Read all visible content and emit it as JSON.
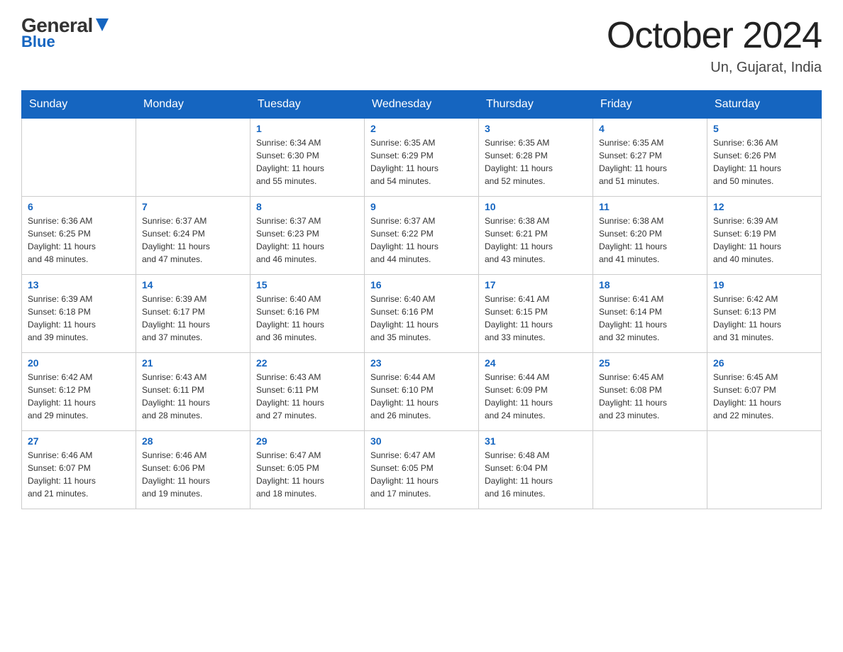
{
  "logo": {
    "general": "General",
    "blue": "Blue"
  },
  "title": "October 2024",
  "location": "Un, Gujarat, India",
  "weekdays": [
    "Sunday",
    "Monday",
    "Tuesday",
    "Wednesday",
    "Thursday",
    "Friday",
    "Saturday"
  ],
  "weeks": [
    [
      {
        "day": "",
        "info": ""
      },
      {
        "day": "",
        "info": ""
      },
      {
        "day": "1",
        "info": "Sunrise: 6:34 AM\nSunset: 6:30 PM\nDaylight: 11 hours\nand 55 minutes."
      },
      {
        "day": "2",
        "info": "Sunrise: 6:35 AM\nSunset: 6:29 PM\nDaylight: 11 hours\nand 54 minutes."
      },
      {
        "day": "3",
        "info": "Sunrise: 6:35 AM\nSunset: 6:28 PM\nDaylight: 11 hours\nand 52 minutes."
      },
      {
        "day": "4",
        "info": "Sunrise: 6:35 AM\nSunset: 6:27 PM\nDaylight: 11 hours\nand 51 minutes."
      },
      {
        "day": "5",
        "info": "Sunrise: 6:36 AM\nSunset: 6:26 PM\nDaylight: 11 hours\nand 50 minutes."
      }
    ],
    [
      {
        "day": "6",
        "info": "Sunrise: 6:36 AM\nSunset: 6:25 PM\nDaylight: 11 hours\nand 48 minutes."
      },
      {
        "day": "7",
        "info": "Sunrise: 6:37 AM\nSunset: 6:24 PM\nDaylight: 11 hours\nand 47 minutes."
      },
      {
        "day": "8",
        "info": "Sunrise: 6:37 AM\nSunset: 6:23 PM\nDaylight: 11 hours\nand 46 minutes."
      },
      {
        "day": "9",
        "info": "Sunrise: 6:37 AM\nSunset: 6:22 PM\nDaylight: 11 hours\nand 44 minutes."
      },
      {
        "day": "10",
        "info": "Sunrise: 6:38 AM\nSunset: 6:21 PM\nDaylight: 11 hours\nand 43 minutes."
      },
      {
        "day": "11",
        "info": "Sunrise: 6:38 AM\nSunset: 6:20 PM\nDaylight: 11 hours\nand 41 minutes."
      },
      {
        "day": "12",
        "info": "Sunrise: 6:39 AM\nSunset: 6:19 PM\nDaylight: 11 hours\nand 40 minutes."
      }
    ],
    [
      {
        "day": "13",
        "info": "Sunrise: 6:39 AM\nSunset: 6:18 PM\nDaylight: 11 hours\nand 39 minutes."
      },
      {
        "day": "14",
        "info": "Sunrise: 6:39 AM\nSunset: 6:17 PM\nDaylight: 11 hours\nand 37 minutes."
      },
      {
        "day": "15",
        "info": "Sunrise: 6:40 AM\nSunset: 6:16 PM\nDaylight: 11 hours\nand 36 minutes."
      },
      {
        "day": "16",
        "info": "Sunrise: 6:40 AM\nSunset: 6:16 PM\nDaylight: 11 hours\nand 35 minutes."
      },
      {
        "day": "17",
        "info": "Sunrise: 6:41 AM\nSunset: 6:15 PM\nDaylight: 11 hours\nand 33 minutes."
      },
      {
        "day": "18",
        "info": "Sunrise: 6:41 AM\nSunset: 6:14 PM\nDaylight: 11 hours\nand 32 minutes."
      },
      {
        "day": "19",
        "info": "Sunrise: 6:42 AM\nSunset: 6:13 PM\nDaylight: 11 hours\nand 31 minutes."
      }
    ],
    [
      {
        "day": "20",
        "info": "Sunrise: 6:42 AM\nSunset: 6:12 PM\nDaylight: 11 hours\nand 29 minutes."
      },
      {
        "day": "21",
        "info": "Sunrise: 6:43 AM\nSunset: 6:11 PM\nDaylight: 11 hours\nand 28 minutes."
      },
      {
        "day": "22",
        "info": "Sunrise: 6:43 AM\nSunset: 6:11 PM\nDaylight: 11 hours\nand 27 minutes."
      },
      {
        "day": "23",
        "info": "Sunrise: 6:44 AM\nSunset: 6:10 PM\nDaylight: 11 hours\nand 26 minutes."
      },
      {
        "day": "24",
        "info": "Sunrise: 6:44 AM\nSunset: 6:09 PM\nDaylight: 11 hours\nand 24 minutes."
      },
      {
        "day": "25",
        "info": "Sunrise: 6:45 AM\nSunset: 6:08 PM\nDaylight: 11 hours\nand 23 minutes."
      },
      {
        "day": "26",
        "info": "Sunrise: 6:45 AM\nSunset: 6:07 PM\nDaylight: 11 hours\nand 22 minutes."
      }
    ],
    [
      {
        "day": "27",
        "info": "Sunrise: 6:46 AM\nSunset: 6:07 PM\nDaylight: 11 hours\nand 21 minutes."
      },
      {
        "day": "28",
        "info": "Sunrise: 6:46 AM\nSunset: 6:06 PM\nDaylight: 11 hours\nand 19 minutes."
      },
      {
        "day": "29",
        "info": "Sunrise: 6:47 AM\nSunset: 6:05 PM\nDaylight: 11 hours\nand 18 minutes."
      },
      {
        "day": "30",
        "info": "Sunrise: 6:47 AM\nSunset: 6:05 PM\nDaylight: 11 hours\nand 17 minutes."
      },
      {
        "day": "31",
        "info": "Sunrise: 6:48 AM\nSunset: 6:04 PM\nDaylight: 11 hours\nand 16 minutes."
      },
      {
        "day": "",
        "info": ""
      },
      {
        "day": "",
        "info": ""
      }
    ]
  ]
}
